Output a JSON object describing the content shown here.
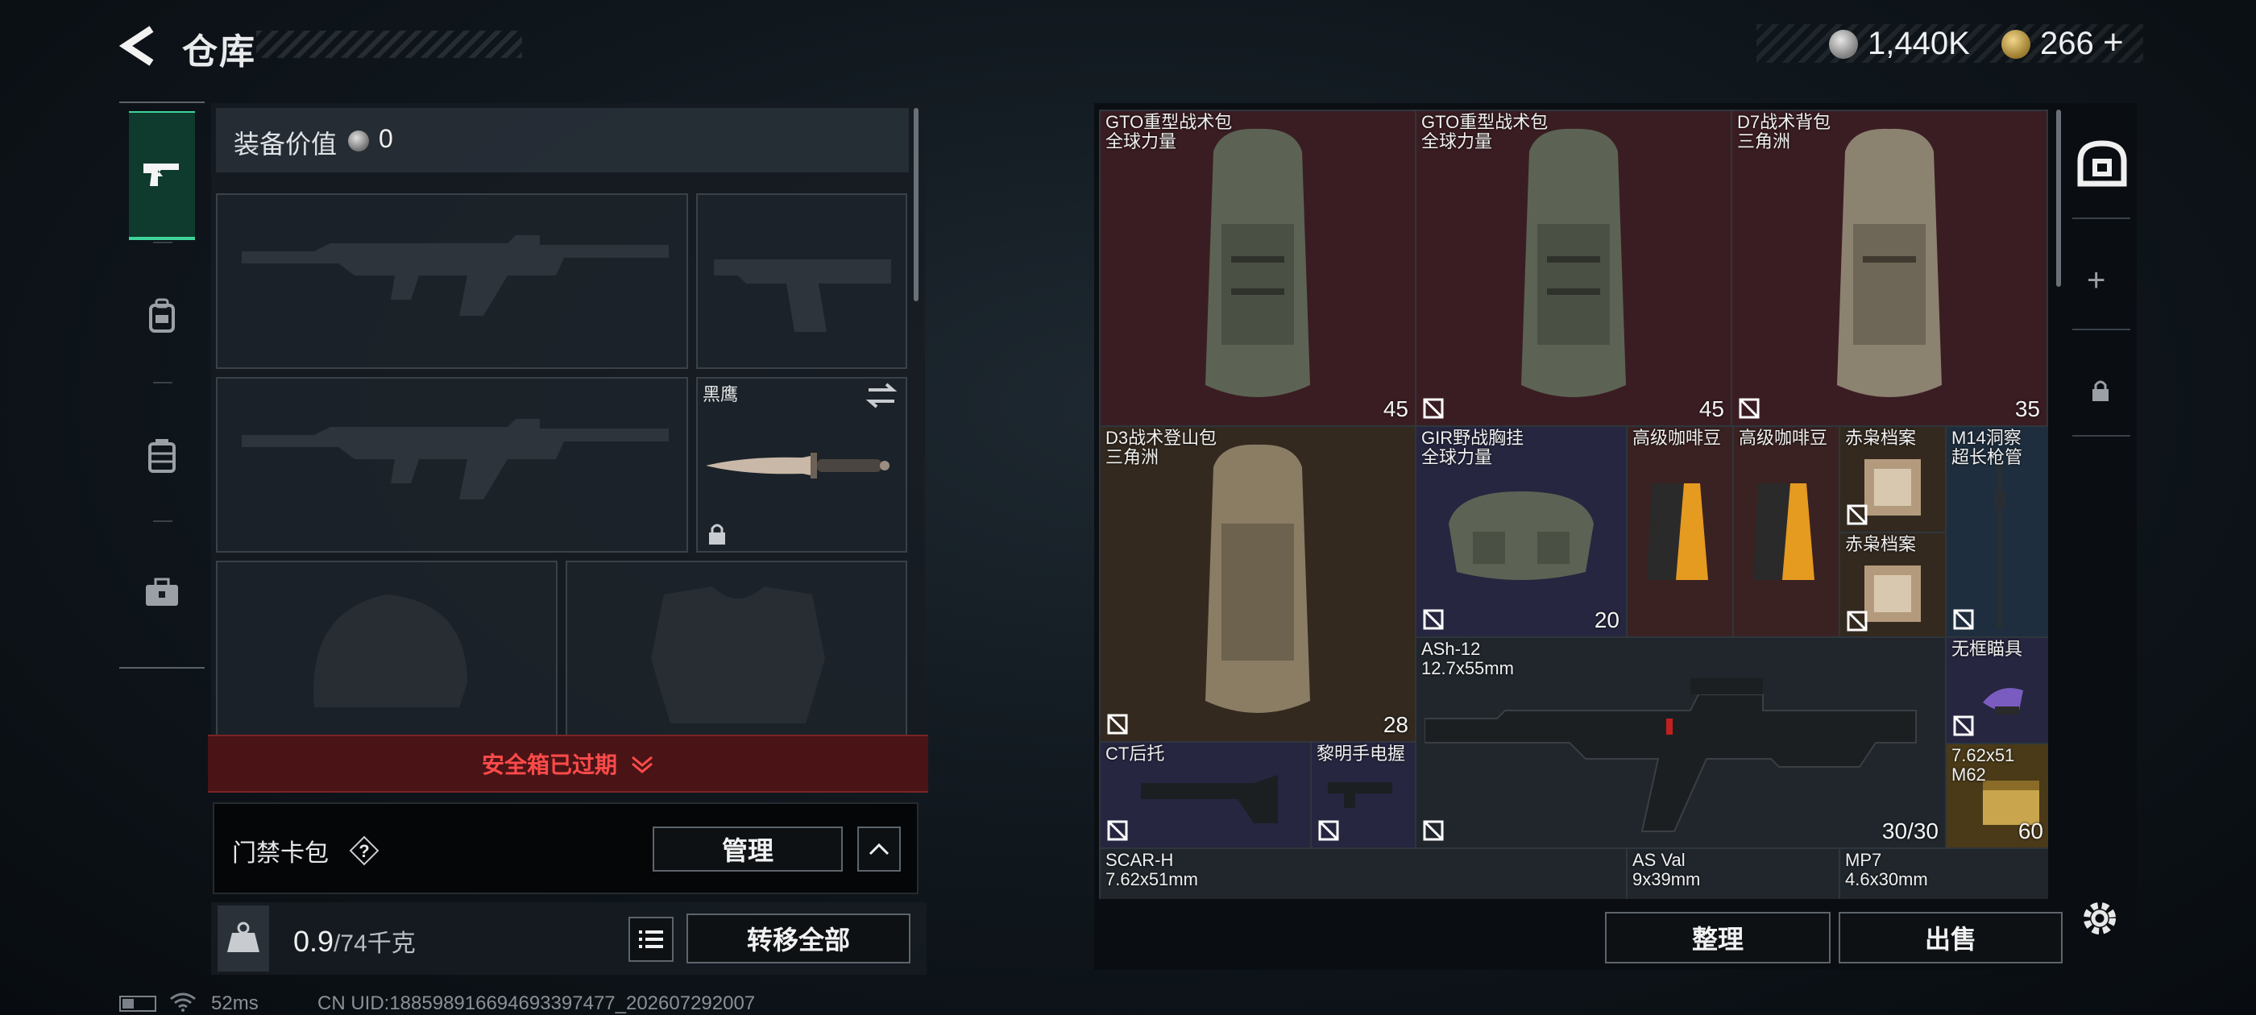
{
  "header": {
    "title": "仓库",
    "silver_amount": "1,440K",
    "gold_amount": "266",
    "add_label": "+"
  },
  "equipment": {
    "value_label": "装备价值",
    "value": "0",
    "knife_name": "黑鹰",
    "safe_box_status": "安全箱已过期",
    "keycard_label": "门禁卡包",
    "help_label": "?",
    "manage_label": "管理",
    "weight_current": "0.9",
    "weight_max": "/74千克",
    "transfer_all_label": "转移全部"
  },
  "status": {
    "ping": "52ms",
    "uid": "CN UID:1885989166946933974​77_202607292007"
  },
  "stash": {
    "items": [
      {
        "name": "GTO重型战术包",
        "sub": "全球力量",
        "cap": "45"
      },
      {
        "name": "GTO重型战术包",
        "sub": "全球力量",
        "cap": "45"
      },
      {
        "name": "D7战术背包",
        "sub": "三角洲",
        "cap": "35"
      },
      {
        "name": "D3战术登山包",
        "sub": "三角洲",
        "cap": "28"
      },
      {
        "name": "GIR野战胸挂",
        "sub": "全球力量",
        "cap": "20"
      },
      {
        "name": "高级咖啡豆"
      },
      {
        "name": "高级咖啡豆"
      },
      {
        "name": "赤枭档案"
      },
      {
        "name": "赤枭档案"
      },
      {
        "name": "M14洞察",
        "sub": "超长枪管"
      },
      {
        "name": "ASh-12",
        "sub": "12.7x55mm",
        "ammo": "30/30"
      },
      {
        "name": "无框瞄具"
      },
      {
        "name": "CT后托"
      },
      {
        "name": "黎明手电握"
      },
      {
        "name": "7.62x51",
        "sub": "M62",
        "qty": "60"
      },
      {
        "name": "SCAR-H",
        "sub": "7.62x51mm"
      },
      {
        "name": "AS Val",
        "sub": "9x39mm"
      },
      {
        "name": "MP7",
        "sub": "4.6x30mm"
      }
    ],
    "sort_label": "整理",
    "sell_label": "出售",
    "expand_label": "+"
  },
  "colors": {
    "accent_green": "#3fd49a",
    "warning_red": "#ff4a4a",
    "cell_red": "#3a1d22",
    "cell_purple": "#262640",
    "cell_gold": "#4a3a18"
  },
  "icons": [
    "back-arrow-icon",
    "pistol-icon",
    "bag-icon",
    "vest-icon",
    "toolbox-icon",
    "safe-icon",
    "lock-icon",
    "settings-icon",
    "list-icon",
    "weight-icon",
    "swap-icon"
  ]
}
